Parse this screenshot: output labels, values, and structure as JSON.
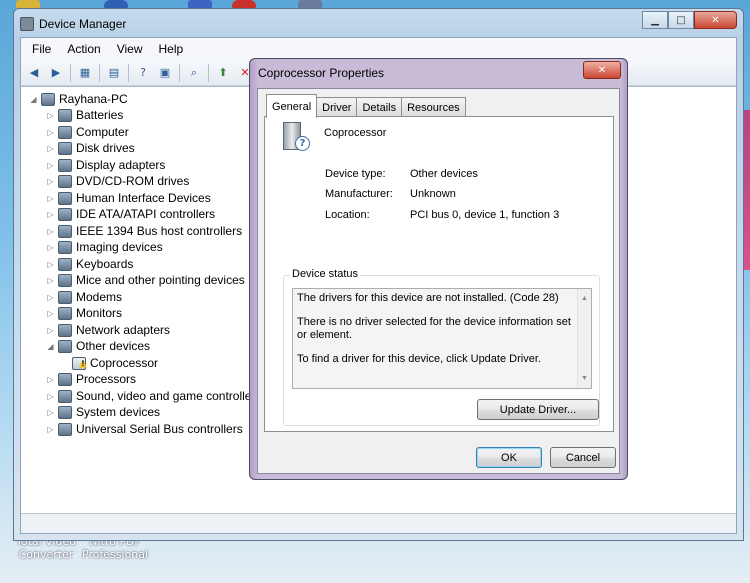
{
  "desktop": {
    "labels": [
      "Total Video\nConverter",
      "Nitro PDF\nProfessional"
    ]
  },
  "device_manager": {
    "title": "Device Manager",
    "menu": [
      "File",
      "Action",
      "View",
      "Help"
    ],
    "tree": {
      "root": "Rayhana-PC",
      "items": [
        "Batteries",
        "Computer",
        "Disk drives",
        "Display adapters",
        "DVD/CD-ROM drives",
        "Human Interface Devices",
        "IDE ATA/ATAPI controllers",
        "IEEE 1394 Bus host controllers",
        "Imaging devices",
        "Keyboards",
        "Mice and other pointing devices",
        "Modems",
        "Monitors",
        "Network adapters",
        "Other devices",
        "Processors",
        "Sound, video and game controllers",
        "System devices",
        "Universal Serial Bus controllers"
      ],
      "other_child": "Coprocessor"
    }
  },
  "dialog": {
    "title": "Coprocessor Properties",
    "tabs": [
      "General",
      "Driver",
      "Details",
      "Resources"
    ],
    "device_name": "Coprocessor",
    "fields": [
      {
        "label": "Device type:",
        "value": "Other devices"
      },
      {
        "label": "Manufacturer:",
        "value": "Unknown"
      },
      {
        "label": "Location:",
        "value": "PCI bus 0, device 1, function 3"
      }
    ],
    "status_legend": "Device status",
    "status_lines": [
      "The drivers for this device are not installed. (Code 28)",
      "There is no driver selected for the device information set or element.",
      "To find a driver for this device, click Update Driver."
    ],
    "update_driver_label": "Update Driver...",
    "ok_label": "OK",
    "cancel_label": "Cancel"
  }
}
